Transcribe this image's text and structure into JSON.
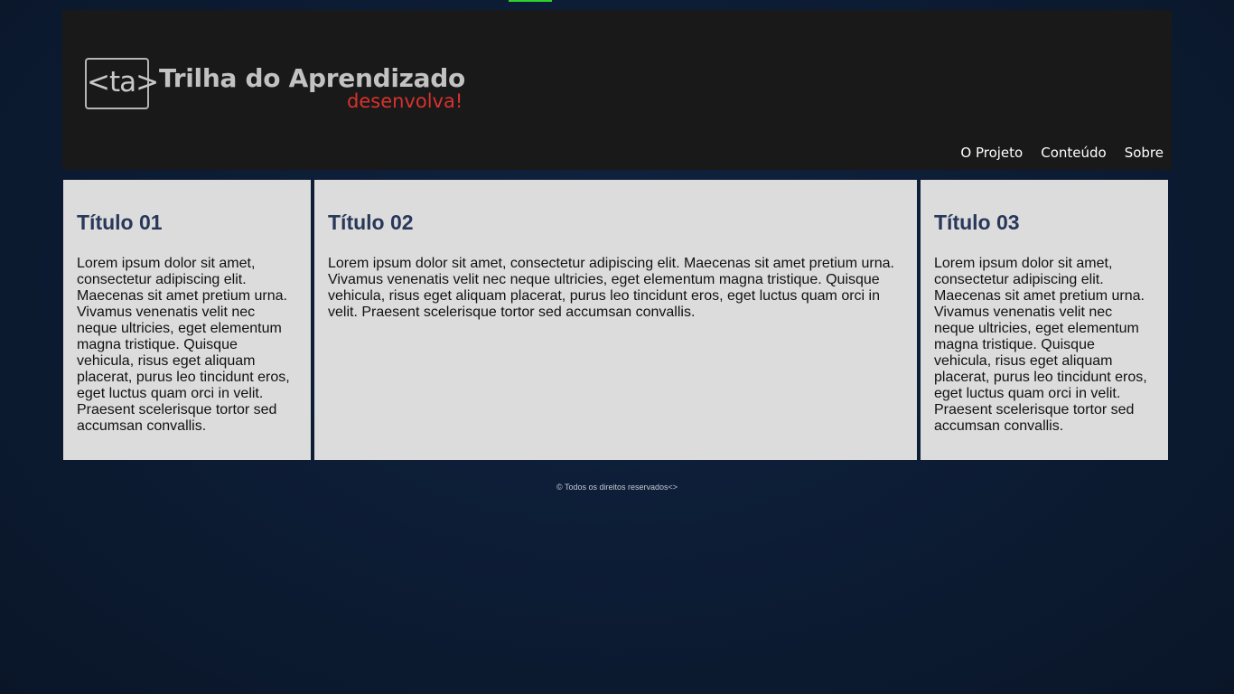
{
  "header": {
    "logo": {
      "mark": "<ta>",
      "title": "Trilha do Aprendizado",
      "tagline": "desenvolva!"
    },
    "nav": [
      {
        "label": "O Projeto"
      },
      {
        "label": "Conteúdo"
      },
      {
        "label": "Sobre"
      }
    ]
  },
  "cards": [
    {
      "title": "Título 01",
      "text": "Lorem ipsum dolor sit amet, consectetur adipiscing elit. Maecenas sit amet pretium urna. Vivamus venenatis velit nec neque ultricies, eget elementum magna tristique. Quisque vehicula, risus eget aliquam placerat, purus leo tincidunt eros, eget luctus quam orci in velit. Praesent scelerisque tortor sed accumsan convallis."
    },
    {
      "title": "Título 02",
      "text": "Lorem ipsum dolor sit amet, consectetur adipiscing elit. Maecenas sit amet pretium urna. Vivamus venenatis velit nec neque ultricies, eget elementum magna tristique. Quisque vehicula, risus eget aliquam placerat, purus leo tincidunt eros, eget luctus quam orci in velit. Praesent scelerisque tortor sed accumsan convallis."
    },
    {
      "title": "Título 03",
      "text": "Lorem ipsum dolor sit amet, consectetur adipiscing elit. Maecenas sit amet pretium urna. Vivamus venenatis velit nec neque ultricies, eget elementum magna tristique. Quisque vehicula, risus eget aliquam placerat, purus leo tincidunt eros, eget luctus quam orci in velit. Praesent scelerisque tortor sed accumsan convallis."
    }
  ],
  "footer": {
    "text": "© Todos os direitos reservados<>"
  },
  "colors": {
    "background": "#0d1d36",
    "header_bg": "#191919",
    "card_bg": "#dcdcdc",
    "card_title": "#28385a",
    "tagline": "#d8322e",
    "top_indicator": "#2fd12f"
  }
}
